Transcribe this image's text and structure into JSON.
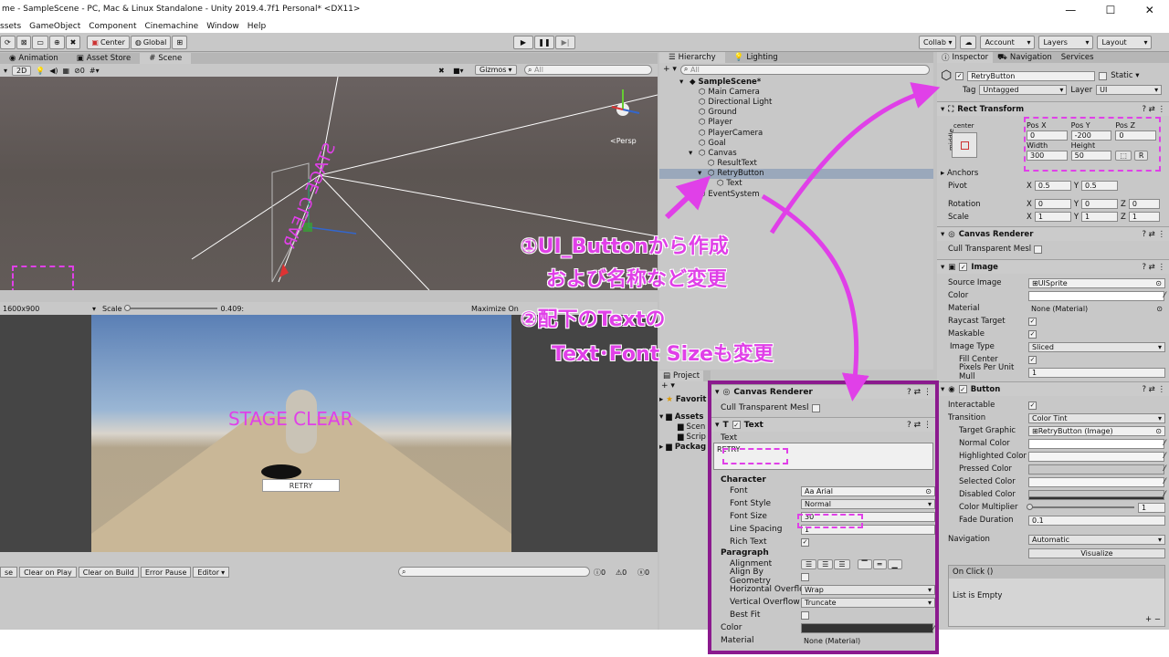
{
  "window": {
    "title": "me - SampleScene - PC, Mac & Linux Standalone - Unity 2019.4.7f1 Personal* <DX11>",
    "min": "—",
    "max": "☐",
    "close": "✕"
  },
  "menu": [
    "ssets",
    "GameObject",
    "Component",
    "Cinemachine",
    "Window",
    "Help"
  ],
  "toolbar": {
    "center": "Center",
    "global": "Global",
    "collab": "Collab ▾",
    "account": "Account",
    "layers": "Layers",
    "layout": "Layout"
  },
  "scene_tabs": [
    "Animation",
    "Asset Store",
    "Scene"
  ],
  "scene_toolbar": {
    "mode": "2D",
    "gizmos": "Gizmos",
    "search_placeholder": "All",
    "persp": "<Persp",
    "audio": "0"
  },
  "scene_text": "STAGE CLEAR",
  "game_toolbar": {
    "resolution": "1600x900",
    "scale_label": "Scale",
    "scale_value": "0.409:",
    "maximize": "Maximize On"
  },
  "game_view": {
    "stage_clear": "STAGE CLEAR",
    "retry": "RETRY"
  },
  "hierarchy": {
    "tabs": [
      "Hierarchy",
      "Lighting"
    ],
    "search_placeholder": "All",
    "items": [
      {
        "label": "SampleScene*",
        "indent": 0
      },
      {
        "label": "Main Camera",
        "indent": 1
      },
      {
        "label": "Directional Light",
        "indent": 1
      },
      {
        "label": "Ground",
        "indent": 1
      },
      {
        "label": "Player",
        "indent": 1
      },
      {
        "label": "PlayerCamera",
        "indent": 1
      },
      {
        "label": "Goal",
        "indent": 1
      },
      {
        "label": "Canvas",
        "indent": 1
      },
      {
        "label": "ResultText",
        "indent": 2
      },
      {
        "label": "RetryButton",
        "indent": 2
      },
      {
        "label": "Text",
        "indent": 3
      },
      {
        "label": "EventSystem",
        "indent": 1
      }
    ]
  },
  "project": {
    "tab": "Project",
    "items": [
      "Favorit",
      "Assets",
      "Scen",
      "Scrip",
      "Packag"
    ]
  },
  "console": {
    "clear": "se",
    "clear_on_play": "Clear on Play",
    "clear_on_build": "Clear on Build",
    "error_pause": "Error Pause",
    "editor": "Editor",
    "info": "0",
    "warn": "0",
    "err": "0"
  },
  "inspector": {
    "tabs": [
      "Inspector",
      "Navigation",
      "Services"
    ],
    "name": "RetryButton",
    "static": "Static",
    "tag_label": "Tag",
    "tag": "Untagged",
    "layer_label": "Layer",
    "layer": "UI",
    "rect": {
      "title": "Rect Transform",
      "center": "center",
      "middle": "middle",
      "posx_l": "Pos X",
      "posy_l": "Pos Y",
      "posz_l": "Pos Z",
      "posx": "0",
      "posy": "-200",
      "posz": "0",
      "w_l": "Width",
      "h_l": "Height",
      "w": "300",
      "h": "50",
      "r": "R",
      "anchors": "Anchors",
      "pivot": "Pivot",
      "px": "0.5",
      "py": "0.5",
      "rotation": "Rotation",
      "rx": "0",
      "ry": "0",
      "rz": "0",
      "scale": "Scale",
      "sx": "1",
      "sy": "1",
      "sz": "1"
    },
    "canvas_renderer": {
      "title": "Canvas Renderer",
      "cull": "Cull Transparent Mesl"
    },
    "image": {
      "title": "Image",
      "source_l": "Source Image",
      "source": "UISprite",
      "color_l": "Color",
      "material_l": "Material",
      "material": "None (Material)",
      "raycast": "Raycast Target",
      "maskable": "Maskable",
      "type_l": "Image Type",
      "type": "Sliced",
      "fill": "Fill Center",
      "ppu_l": "Pixels Per Unit Mull",
      "ppu": "1"
    },
    "button": {
      "title": "Button",
      "interactable": "Interactable",
      "transition_l": "Transition",
      "transition": "Color Tint",
      "target_l": "Target Graphic",
      "target": "RetryButton (Image)",
      "normal": "Normal Color",
      "highlight": "Highlighted Color",
      "pressed": "Pressed Color",
      "selected": "Selected Color",
      "disabled": "Disabled Color",
      "mult_l": "Color Multiplier",
      "mult": "1",
      "fade_l": "Fade Duration",
      "fade": "0.1",
      "nav_l": "Navigation",
      "nav": "Automatic",
      "visualize": "Visualize",
      "onclick": "On Click ()",
      "empty": "List is Empty"
    }
  },
  "callout": {
    "cr_title": "Canvas Renderer",
    "cull": "Cull Transparent Mesl",
    "text_title": "Text",
    "text_l": "Text",
    "text_value": "RETRY",
    "character": "Character",
    "font_l": "Font",
    "font": "Arial",
    "style_l": "Font Style",
    "style": "Normal",
    "size_l": "Font Size",
    "size": "30",
    "spacing_l": "Line Spacing",
    "spacing": "1",
    "rich_l": "Rich Text",
    "paragraph": "Paragraph",
    "align_l": "Alignment",
    "geom_l": "Align By Geometry",
    "hover_l": "Horizontal Overflov",
    "hover": "Wrap",
    "vover_l": "Vertical Overflow",
    "vover": "Truncate",
    "best_l": "Best Fit",
    "color_l": "Color",
    "mat_l": "Material",
    "mat": "None (Material)"
  },
  "notes": [
    "①UI_Buttonから作成",
    "および名称など変更",
    "②配下のTextの",
    "Text･Font Sizeも変更"
  ],
  "colors": {
    "accent": "#e040e8",
    "callout_border": "#8b1a8e",
    "selection": "#9aa8bb"
  }
}
